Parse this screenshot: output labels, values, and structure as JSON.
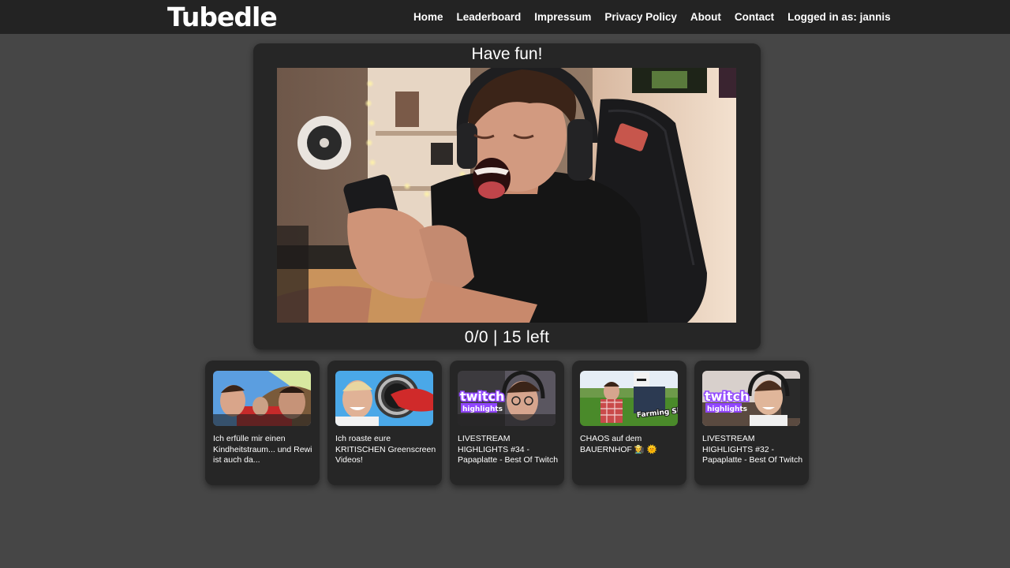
{
  "header": {
    "logo": "Tubedle",
    "nav": {
      "home": "Home",
      "leaderboard": "Leaderboard",
      "impressum": "Impressum",
      "privacy": "Privacy Policy",
      "about": "About",
      "contact": "Contact",
      "user": "Logged in as: jannis"
    }
  },
  "game": {
    "title": "Have fun!",
    "score": "0/0 | 15 left"
  },
  "cards": [
    {
      "title": "Ich erfülle mir einen Kindheitstraum... und Rewi ist auch da..."
    },
    {
      "title": "Ich roaste eure KRITISCHEN Greenscreen Videos!"
    },
    {
      "title": "LIVESTREAM HIGHLIGHTS #34 - Papaplatte - Best Of Twitch",
      "badge": "twitch",
      "badge_sub": "highlights"
    },
    {
      "title": "CHAOS auf dem BAUERNHOF 👩‍🌾 🌞",
      "badge": "Farming Simulator"
    },
    {
      "title": "LIVESTREAM HIGHLIGHTS #32 - Papaplatte - Best Of Twitch",
      "badge": "twitch",
      "badge_sub": "highlights"
    }
  ],
  "colors": {
    "page_bg": "#464646",
    "topbar_bg": "#232323",
    "panel_bg": "#262626",
    "twitch_purple": "#9146ff"
  }
}
